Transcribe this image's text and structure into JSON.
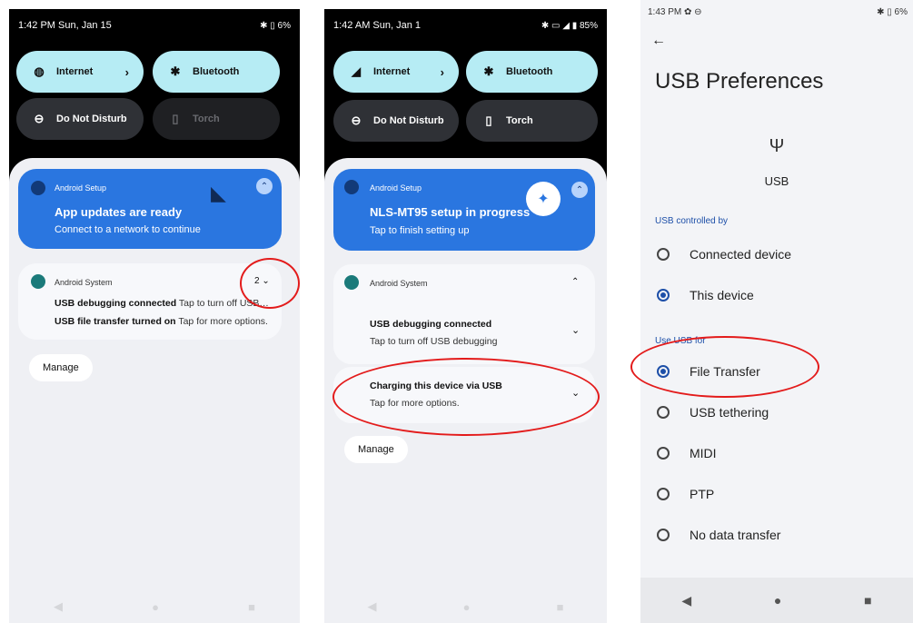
{
  "screen1": {
    "status": {
      "time": "1:42 PM Sun, Jan 15",
      "right": "✱ ▯ 6%"
    },
    "tiles": {
      "internet": "Internet",
      "bluetooth": "Bluetooth",
      "dnd": "Do Not Disturb",
      "torch": "Torch"
    },
    "setup_card": {
      "app": "Android Setup",
      "title": "App updates are ready",
      "text": "Connect to a network to continue"
    },
    "system_card": {
      "app": "Android System",
      "count": "2",
      "row1_bold": "USB debugging connected",
      "row1_text": "Tap to turn off USB…",
      "row2_bold": "USB file transfer turned on",
      "row2_text": "Tap for more options."
    },
    "manage": "Manage"
  },
  "screen2": {
    "status": {
      "time": "1:42 AM Sun, Jan 1",
      "right": "✱ ▭ ◢ ▮ 85%"
    },
    "tiles": {
      "internet": "Internet",
      "bluetooth": "Bluetooth",
      "dnd": "Do Not Disturb",
      "torch": "Torch"
    },
    "setup_card": {
      "app": "Android Setup",
      "title": "NLS-MT95 setup in progress",
      "text": "Tap to finish setting up"
    },
    "system_card": {
      "app": "Android System"
    },
    "debug": {
      "title": "USB debugging connected",
      "text": "Tap to turn off USB debugging"
    },
    "charging": {
      "title": "Charging this device via USB",
      "text": "Tap for more options."
    },
    "manage": "Manage"
  },
  "screen3": {
    "status": {
      "time": "1:43 PM ✿ ⊖",
      "right": "✱ ▯ 6%"
    },
    "title": "USB Preferences",
    "usb_label": "USB",
    "controlled_by_header": "USB controlled by",
    "controlled_by": [
      {
        "label": "Connected device",
        "selected": false
      },
      {
        "label": "This device",
        "selected": true
      }
    ],
    "use_for_header": "Use USB for",
    "use_for": [
      {
        "label": "File Transfer",
        "selected": true
      },
      {
        "label": "USB tethering",
        "selected": false
      },
      {
        "label": "MIDI",
        "selected": false
      },
      {
        "label": "PTP",
        "selected": false
      },
      {
        "label": "No data transfer",
        "selected": false
      }
    ]
  },
  "colors": {
    "accent": "#2a76e0",
    "tile_on": "#b6ecf4",
    "highlight": "#e31b1b",
    "radio_on": "#1d4fa8"
  }
}
